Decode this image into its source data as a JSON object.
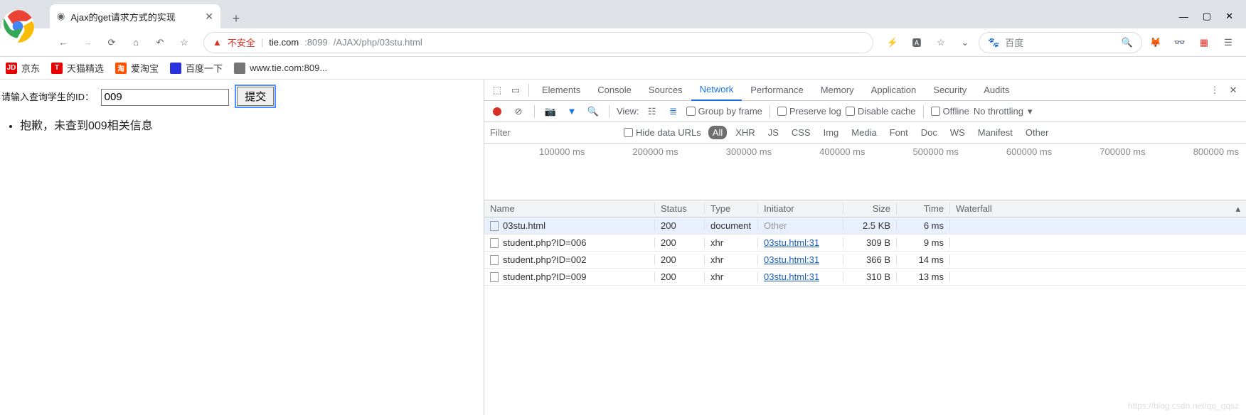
{
  "window": {
    "min": "—",
    "max": "▢",
    "close": "✕"
  },
  "tab": {
    "title": "Ajax的get请求方式的实现",
    "close": "✕",
    "new": "+"
  },
  "nav": {
    "not_secure": "不安全",
    "url_host": "tie.com",
    "url_port": ":8099",
    "url_path": "/AJAX/php/03stu.html",
    "search_placeholder": "百度"
  },
  "bookmarks": [
    {
      "icon_bg": "#e60000",
      "icon_txt": "JD",
      "label": "京东"
    },
    {
      "icon_bg": "#e60000",
      "icon_txt": "T",
      "label": "天猫精选"
    },
    {
      "icon_bg": "#ff5000",
      "icon_txt": "淘",
      "label": "爱淘宝"
    },
    {
      "icon_bg": "#2932e1",
      "icon_txt": "",
      "label": "百度一下"
    },
    {
      "icon_bg": "#757575",
      "icon_txt": "",
      "label": "www.tie.com:809..."
    }
  ],
  "page": {
    "label": "请输入查询学生的ID：",
    "input_value": "009",
    "submit": "提交",
    "result": "抱歉，未查到009相关信息"
  },
  "devtools": {
    "tabs": [
      "Elements",
      "Console",
      "Sources",
      "Network",
      "Performance",
      "Memory",
      "Application",
      "Security",
      "Audits"
    ],
    "active_tab": "Network",
    "toolbar": {
      "view": "View:",
      "group": "Group by frame",
      "preserve": "Preserve log",
      "disable_cache": "Disable cache",
      "offline": "Offline",
      "throttle": "No throttling"
    },
    "filter": {
      "placeholder": "Filter",
      "hide_urls": "Hide data URLs",
      "types": [
        "All",
        "XHR",
        "JS",
        "CSS",
        "Img",
        "Media",
        "Font",
        "Doc",
        "WS",
        "Manifest",
        "Other"
      ],
      "active_type": "All"
    },
    "timeline_labels": [
      "100000 ms",
      "200000 ms",
      "300000 ms",
      "400000 ms",
      "500000 ms",
      "600000 ms",
      "700000 ms",
      "800000 ms"
    ],
    "columns": [
      "Name",
      "Status",
      "Type",
      "Initiator",
      "Size",
      "Time",
      "Waterfall"
    ],
    "rows": [
      {
        "name": "03stu.html",
        "status": "200",
        "type": "document",
        "initiator": "Other",
        "initiator_link": false,
        "size": "2.5 KB",
        "time": "6 ms",
        "selected": true
      },
      {
        "name": "student.php?ID=006",
        "status": "200",
        "type": "xhr",
        "initiator": "03stu.html:31",
        "initiator_link": true,
        "size": "309 B",
        "time": "9 ms",
        "selected": false
      },
      {
        "name": "student.php?ID=002",
        "status": "200",
        "type": "xhr",
        "initiator": "03stu.html:31",
        "initiator_link": true,
        "size": "366 B",
        "time": "14 ms",
        "selected": false
      },
      {
        "name": "student.php?ID=009",
        "status": "200",
        "type": "xhr",
        "initiator": "03stu.html:31",
        "initiator_link": true,
        "size": "310 B",
        "time": "13 ms",
        "selected": false
      }
    ]
  },
  "watermark": "https://blog.csdn.net/qq_qqsz"
}
